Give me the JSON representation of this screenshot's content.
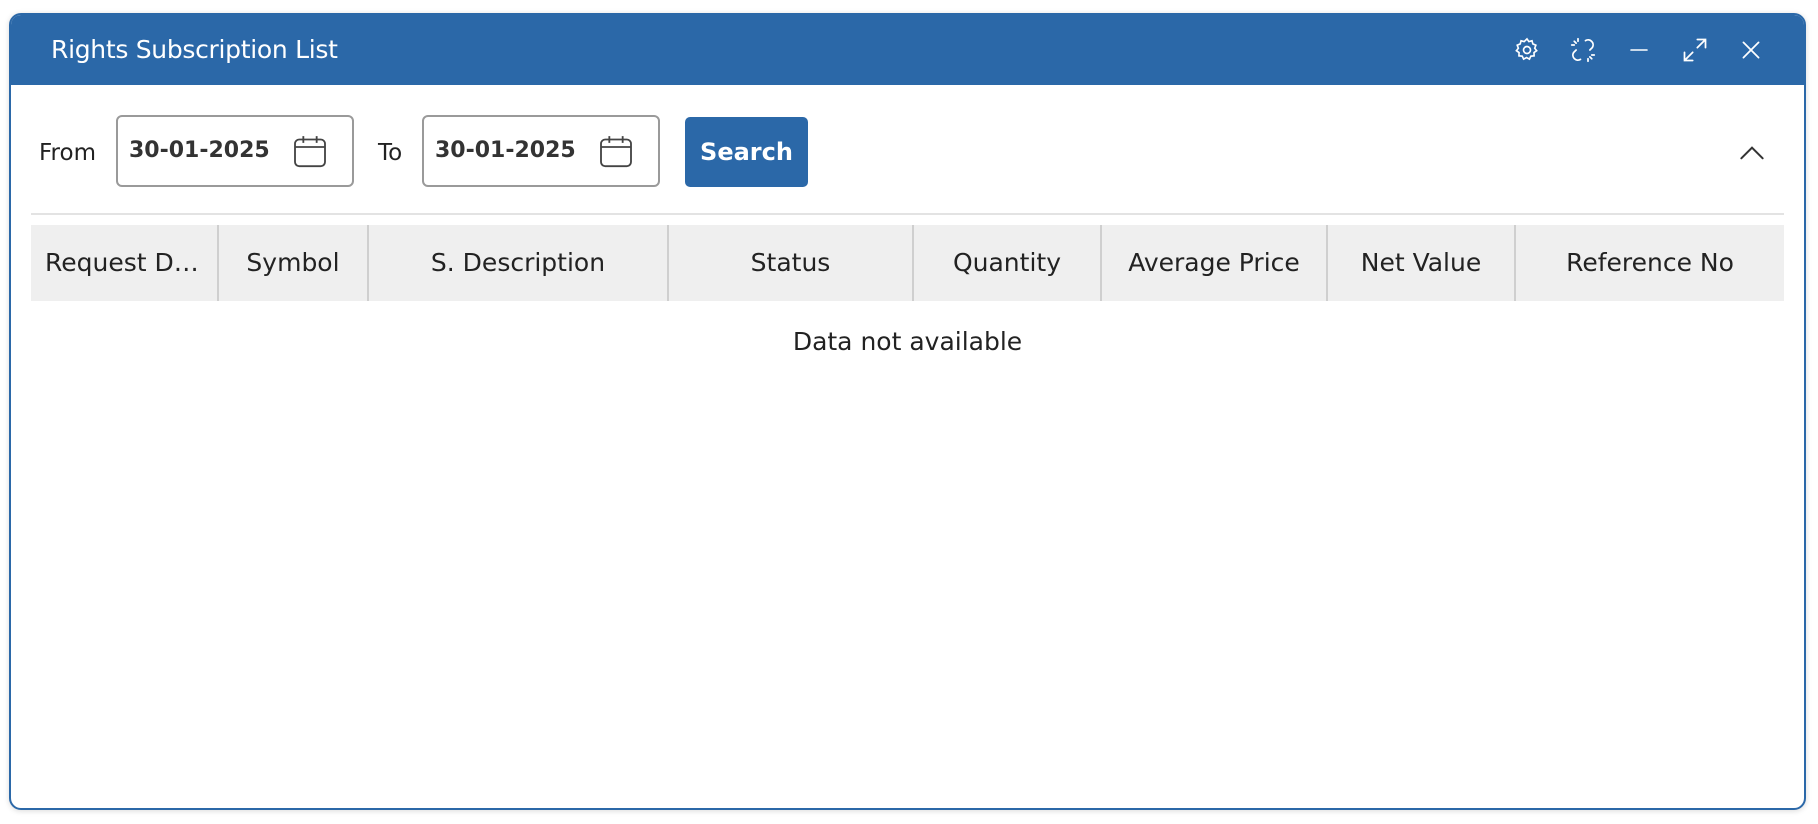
{
  "window": {
    "title": "Rights Subscription List",
    "actions": [
      {
        "icon": "settings-icon"
      },
      {
        "icon": "unlink-icon"
      },
      {
        "icon": "minimize-icon"
      },
      {
        "icon": "expand-icon"
      },
      {
        "icon": "close-icon"
      }
    ]
  },
  "filters": {
    "from_label": "From",
    "from_value": "30-01-2025",
    "to_label": "To",
    "to_value": "30-01-2025",
    "search_label": "Search"
  },
  "table": {
    "columns": [
      "Request Da...",
      "Symbol",
      "S. Description",
      "Status",
      "Quantity",
      "Average Price",
      "Net Value",
      "Reference No"
    ],
    "empty_message": "Data not available"
  },
  "colors": {
    "accent": "#2b68a8",
    "header_bg": "#efefef"
  }
}
